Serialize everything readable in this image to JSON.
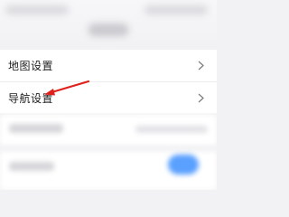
{
  "header": {
    "title": ""
  },
  "settings": {
    "items": [
      {
        "label": "地图设置",
        "icon": "chevron-right-icon"
      },
      {
        "label": "导航设置",
        "icon": "chevron-right-icon"
      }
    ]
  },
  "annotation": {
    "arrow_color": "#e0201b",
    "target": "导航设置"
  },
  "colors": {
    "toggle_on": "#5aa0ff",
    "background": "#f2f2f4"
  }
}
